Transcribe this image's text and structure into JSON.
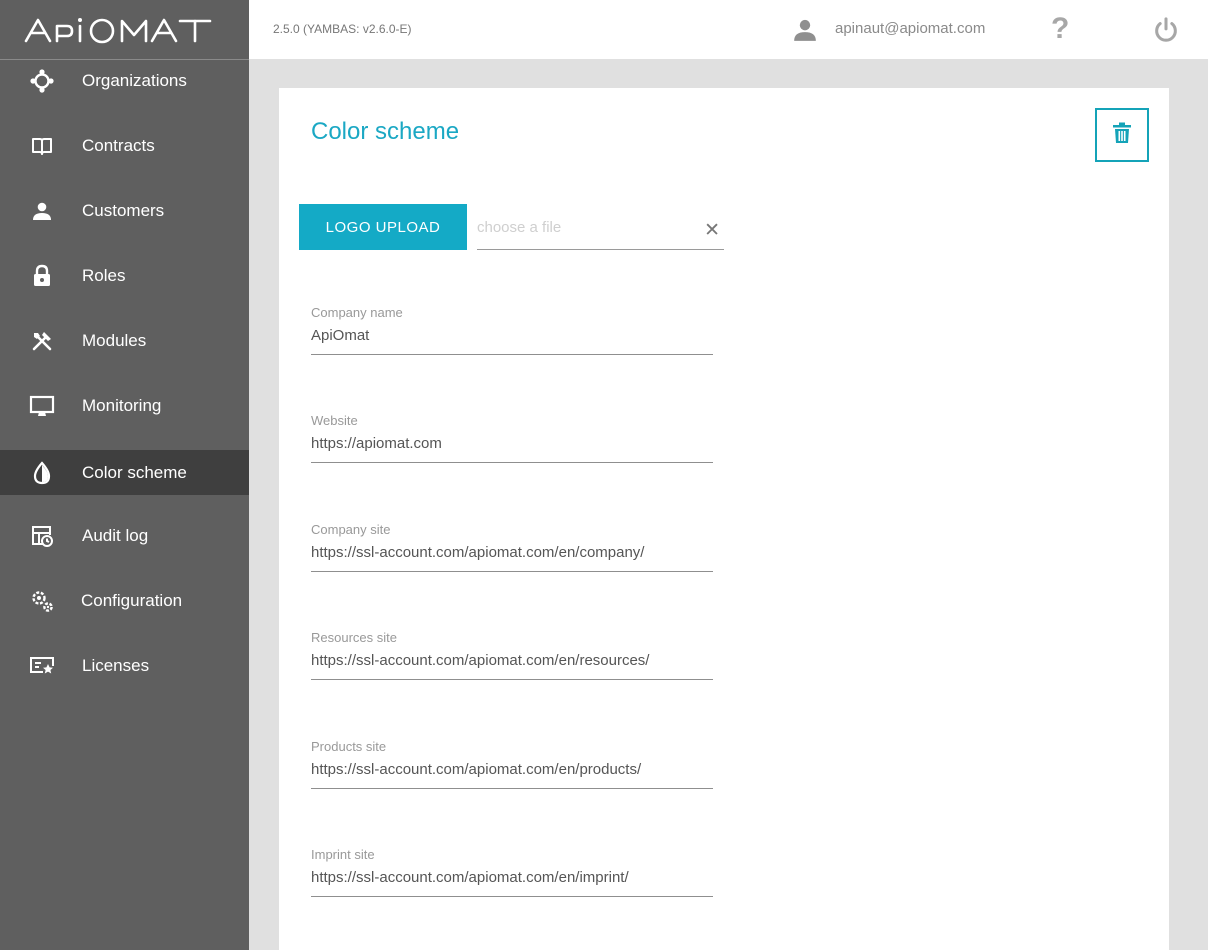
{
  "app": {
    "logo_text": "ApiOmat",
    "version": "2.5.0 (YAMBAS: v2.6.0-E)"
  },
  "user": {
    "email": "apinaut@apiomat.com",
    "help_glyph": "?"
  },
  "sidebar": {
    "items": [
      {
        "label": "Organizations",
        "icon": "organizations-icon",
        "active": false
      },
      {
        "label": "Contracts",
        "icon": "book-icon",
        "active": false
      },
      {
        "label": "Customers",
        "icon": "person-icon",
        "active": false
      },
      {
        "label": "Roles",
        "icon": "lock-icon",
        "active": false
      },
      {
        "label": "Modules",
        "icon": "tools-icon",
        "active": false
      },
      {
        "label": "Monitoring",
        "icon": "monitor-icon",
        "active": false
      },
      {
        "label": "Color scheme",
        "icon": "drop-icon",
        "active": true
      },
      {
        "label": "Audit log",
        "icon": "audit-log-icon",
        "active": false
      },
      {
        "label": "Configuration",
        "icon": "gears-icon",
        "active": false
      },
      {
        "label": "Licenses",
        "icon": "license-icon",
        "active": false
      }
    ]
  },
  "page": {
    "title": "Color scheme",
    "upload_label": "LOGO UPLOAD",
    "file_placeholder": "choose a file",
    "clear_glyph": "✕",
    "fields": [
      {
        "label": "Company name",
        "value": "ApiOmat"
      },
      {
        "label": "Website",
        "value": "https://apiomat.com"
      },
      {
        "label": "Company site",
        "value": "https://ssl-account.com/apiomat.com/en/company/"
      },
      {
        "label": "Resources site",
        "value": "https://ssl-account.com/apiomat.com/en/resources/"
      },
      {
        "label": "Products site",
        "value": "https://ssl-account.com/apiomat.com/en/products/"
      },
      {
        "label": "Imprint site",
        "value": "https://ssl-account.com/apiomat.com/en/imprint/"
      }
    ]
  },
  "colors": {
    "accent": "#14aac6",
    "sidebar_bg": "#5f5f5f",
    "sidebar_active": "#3f3f3f",
    "page_bg": "#e0e0e0"
  }
}
